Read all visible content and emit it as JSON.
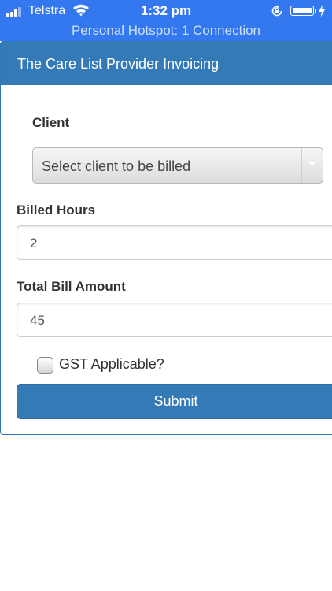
{
  "status_bar": {
    "carrier": "Telstra",
    "time": "1:32 pm",
    "hotspot_text": "Personal Hotspot: 1 Connection",
    "battery_level": 1.0
  },
  "panel": {
    "title": "The Care List Provider Invoicing"
  },
  "form": {
    "client_label": "Client",
    "client_select_value": "Select client to be billed",
    "billed_hours_label": "Billed Hours",
    "billed_hours_value": "2",
    "total_bill_label": "Total Bill Amount",
    "total_bill_value": "45",
    "gst_label": "GST Applicable?",
    "gst_checked": false,
    "submit_label": "Submit"
  },
  "colors": {
    "status_bar_bg": "#3478f0",
    "panel_primary": "#337ab7"
  }
}
